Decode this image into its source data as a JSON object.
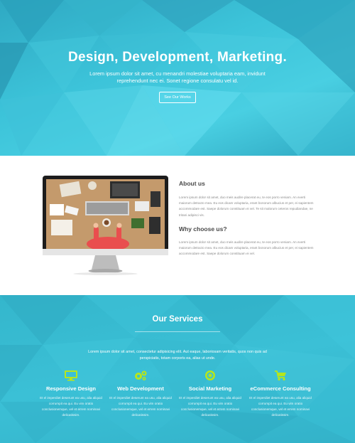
{
  "hero": {
    "title": "Design, Development, Marketing.",
    "subtitle": "Lorem ipsum dolor sit amet, cu menandri molestiae voluptaria eam, invidunt reprehendunt nec ei. Sonet regione consulatu vel id.",
    "button_label": "See Our Works"
  },
  "about": {
    "about_heading": "About us",
    "about_text": "Lorem ipsum dolor sit amet, duo meis audire placerat eu, te eos porro veniam. An everti maiorum detracto mea. Eu eos dicam voluptaria, erant bonorum albucius et per, ei sapientem accommodare est. Saepe dolorum constituam ei vel. Te sit malorum ceteros repudiandae, ne tritani adipisci vis.",
    "why_heading": "Why choose us?",
    "why_text": "Lorem ipsum dolor sit amet, duo meis audire placerat eu, te eos porro veniam. An everti maiorum detracto mea. Eu eos dicam voluptaria, erant bonorum albucius et per, ei sapientem accommodare est. Saepe dolorum constituam ei vel."
  },
  "services": {
    "title": "Our Services",
    "intro": "Lorem ipsum dolor sit amet, consectetur adipisicing elit. Aut eaque, laboriosam veritatis, quos non quis ad perspiciatis, totam corporis ea, alias ut unde.",
    "items": [
      {
        "title": "Responsive Design",
        "icon": "monitor-icon",
        "desc": "Et el imperdiet deserunt ea usu, alia aliquid corrumpit ea qui. Eu vim oratio conclusionemque, vel et errem nominavi delicatissim."
      },
      {
        "title": "Web Development",
        "icon": "gears-icon",
        "desc": "Et el imperdiet deserunt ea usu, alia aliquid corrumpit ea qui. Eu vim oratio conclusionemque, vel et errem nominavi delicatissim."
      },
      {
        "title": "Social Marketing",
        "icon": "target-icon",
        "desc": "Et el imperdiet deserunt ea usu, alia aliquid corrumpit ea qui. Eu vim oratio conclusionemque, vel et errem nominavi delicatissim."
      },
      {
        "title": "eCommerce Consulting",
        "icon": "cart-icon",
        "desc": "Et el imperdiet deserunt ea usu, alia aliquid corrumpit ea qui. Eu vim oratio conclusionemque, vel et errem nominavi delicatissim."
      }
    ]
  },
  "colors": {
    "hero_teal": "#3cc3d9",
    "services_teal": "#3bc0d6",
    "icon_green": "#b5e61d"
  }
}
